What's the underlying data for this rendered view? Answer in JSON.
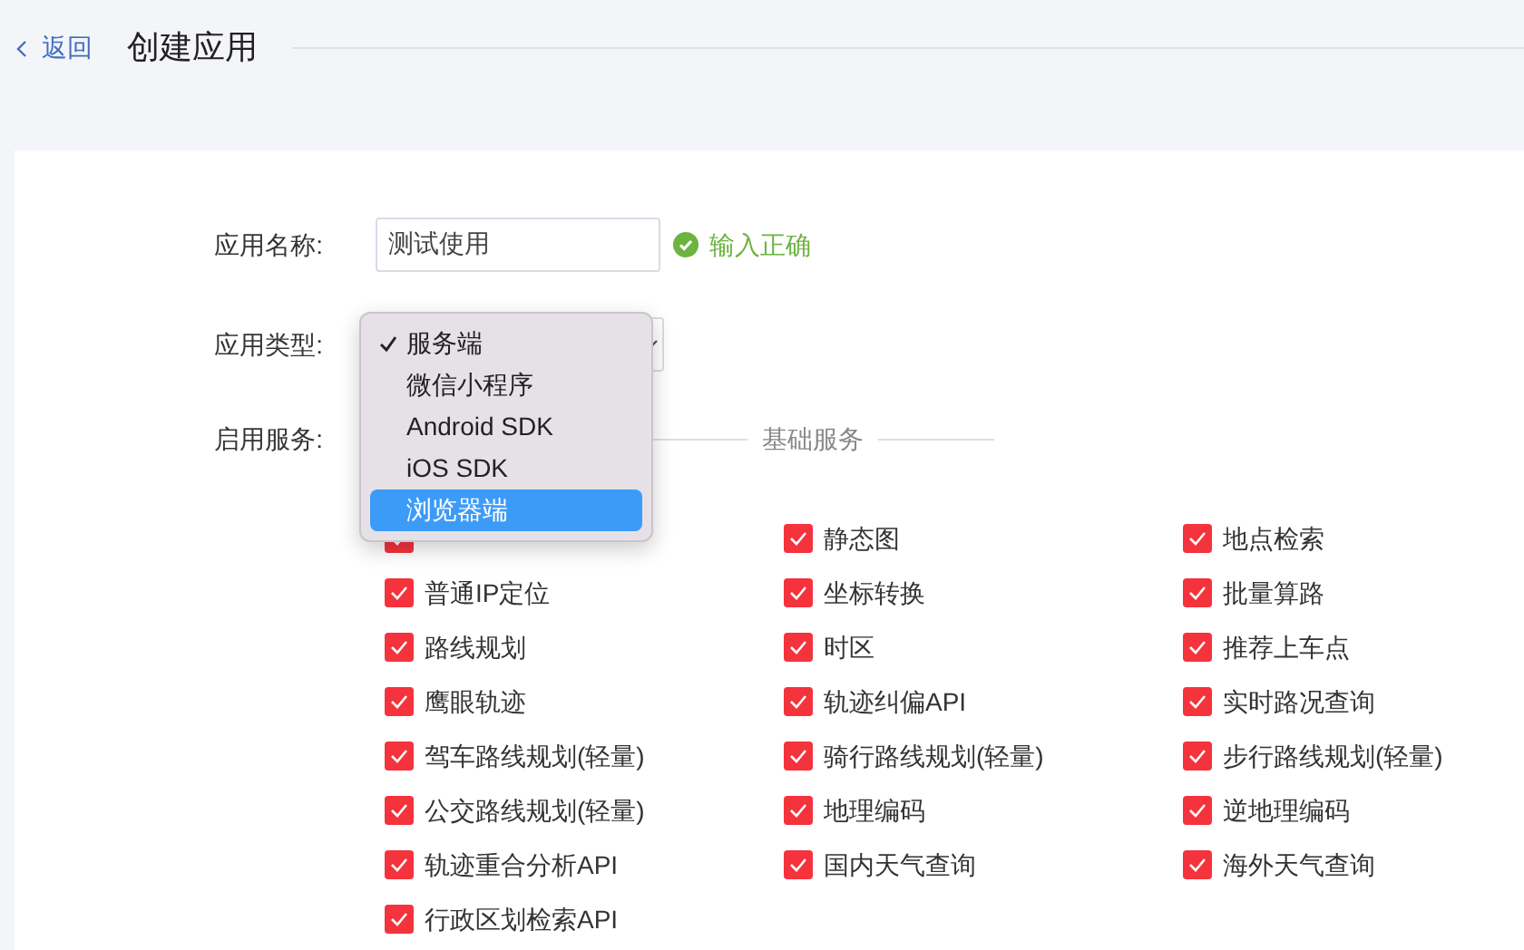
{
  "header": {
    "back_link": "返回",
    "title": "创建应用"
  },
  "form": {
    "name_field": {
      "label": "应用名称:",
      "value": "测试使用",
      "validation": "输入正确"
    },
    "type_field": {
      "label": "应用类型:",
      "dropdown": {
        "open": true,
        "options": [
          {
            "label": "服务端",
            "checked": true,
            "highlighted": false
          },
          {
            "label": "微信小程序",
            "checked": false,
            "highlighted": false
          },
          {
            "label": "Android SDK",
            "checked": false,
            "highlighted": false
          },
          {
            "label": "iOS SDK",
            "checked": false,
            "highlighted": false
          },
          {
            "label": "浏览器端",
            "checked": false,
            "highlighted": true
          }
        ]
      }
    },
    "services_field": {
      "label": "启用服务:",
      "section_title": "基础服务",
      "services": [
        {
          "checked": true
        },
        {
          "label": "静态图",
          "checked": true
        },
        {
          "label": "地点检索",
          "checked": true
        },
        {
          "label": "普通IP定位",
          "checked": true
        },
        {
          "label": "坐标转换",
          "checked": true
        },
        {
          "label": "批量算路",
          "checked": true
        },
        {
          "label": "路线规划",
          "checked": true
        },
        {
          "label": "时区",
          "checked": true
        },
        {
          "label": "推荐上车点",
          "checked": true
        },
        {
          "label": "鹰眼轨迹",
          "checked": true
        },
        {
          "label": "轨迹纠偏API",
          "checked": true
        },
        {
          "label": "实时路况查询",
          "checked": true
        },
        {
          "label": "驾车路线规划(轻量)",
          "checked": true
        },
        {
          "label": "骑行路线规划(轻量)",
          "checked": true
        },
        {
          "label": "步行路线规划(轻量)",
          "checked": true
        },
        {
          "label": "公交路线规划(轻量)",
          "checked": true
        },
        {
          "label": "地理编码",
          "checked": true
        },
        {
          "label": "逆地理编码",
          "checked": true
        },
        {
          "label": "轨迹重合分析API",
          "checked": true
        },
        {
          "label": "国内天气查询",
          "checked": true
        },
        {
          "label": "海外天气查询",
          "checked": true
        },
        {
          "label": "行政区划检索API",
          "checked": true
        }
      ]
    }
  }
}
